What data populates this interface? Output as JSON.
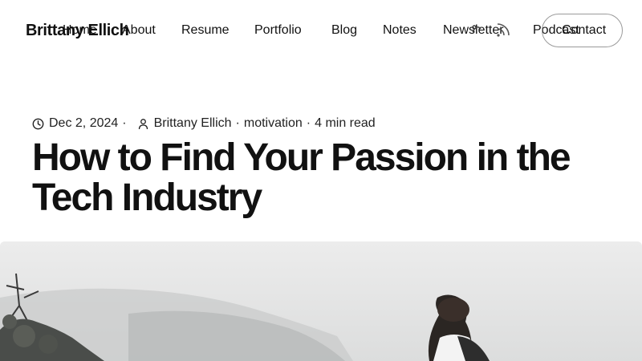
{
  "header": {
    "site_title": "Brittany Ellich",
    "nav": [
      {
        "label": "Home"
      },
      {
        "label": "About"
      },
      {
        "label": "Resume"
      },
      {
        "label": "Portfolio"
      },
      {
        "label": "Blog"
      },
      {
        "label": "Notes"
      },
      {
        "label": "Newsletter"
      },
      {
        "label": "Podcast"
      }
    ],
    "rss_icon": "rss-icon",
    "contact_label": "Contact"
  },
  "post": {
    "date": "Dec 2, 2024",
    "author": "Brittany Ellich",
    "category": "motivation",
    "read_time": "4 min read",
    "title": "How to Find Your Passion in the Tech Industry",
    "meta_icons": [
      "clock-icon",
      "user-icon"
    ]
  },
  "featured_image": {
    "description_icon": "featured-photo"
  }
}
